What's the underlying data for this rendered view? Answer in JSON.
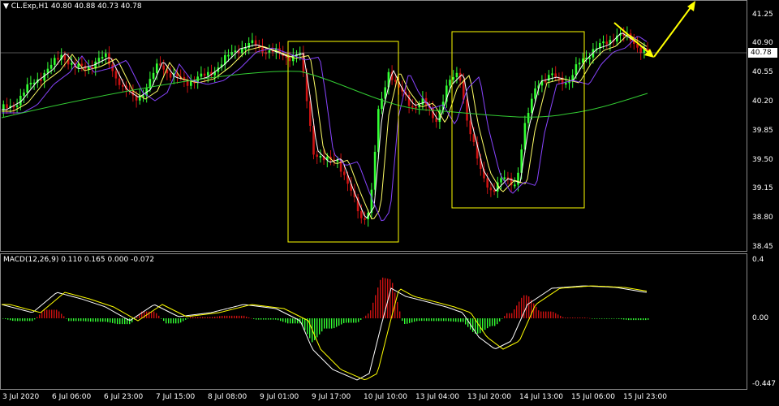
{
  "header": {
    "symbol_label": "CL.Exp,H1",
    "ohlc": "40.80 40.88 40.73 40.78"
  },
  "macd_header": {
    "label": "MACD(12,26,9) 0.110 0.165 0.000 -0.072"
  },
  "current_price": "40.78",
  "price_axis": [
    "41.25",
    "40.90",
    "40.55",
    "40.20",
    "39.85",
    "39.50",
    "39.15",
    "38.80",
    "38.45"
  ],
  "macd_axis": [
    "0.4",
    "0.00",
    "-0.447"
  ],
  "time_axis": [
    "3 Jul 2020",
    "6 Jul 06:00",
    "6 Jul 23:00",
    "7 Jul 15:00",
    "8 Jul 08:00",
    "9 Jul 01:00",
    "9 Jul 17:00",
    "10 Jul 10:00",
    "13 Jul 04:00",
    "13 Jul 20:00",
    "14 Jul 13:00",
    "15 Jul 06:00",
    "15 Jul 23:00"
  ],
  "colors": {
    "bull": "#33ff33",
    "bear": "#cc1111",
    "ma_fast": "#ffffff",
    "ma_mid": "#ffff66",
    "ma_slow": "#8844ff",
    "ma_long": "#33cc33",
    "box": "#ffff00",
    "arrow": "#ffff00",
    "macd_line": "#ffffff",
    "signal_line": "#ffff00"
  },
  "icons": {
    "header_menu": "triangle-down-icon"
  }
}
